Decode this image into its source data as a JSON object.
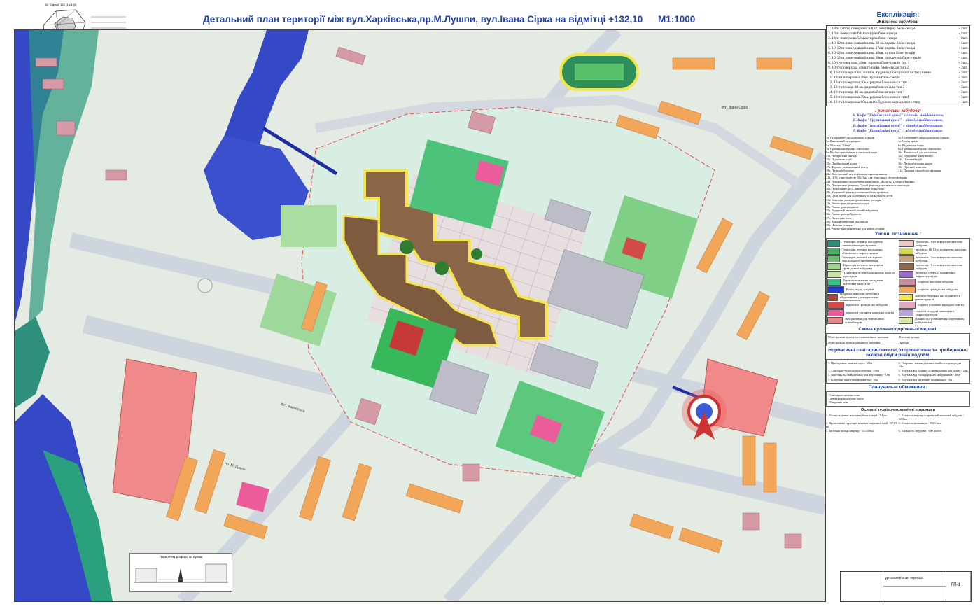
{
  "title": "Детальний план території між вул.Харківська,пр.М.Лушпи, вул.Івана Сірка на  відмітці +132,10",
  "scale": "М1:1000",
  "legend": {
    "explication_title": "Експлікація:",
    "housing_title": "Житлова забудова:",
    "housing": [
      {
        "text": "1. 18ти (20ти) поверхова 64(92) квартирна блок-секція",
        "count": "- 2шт."
      },
      {
        "text": "2. 16ти поверхова 68квартирна блок-секція",
        "count": "- 4шт."
      },
      {
        "text": "3. 14ти поверхова 52квартирна блок-секція",
        "count": "- 10шт."
      },
      {
        "text": "4. 10-12ти поверхова кінцева 38 кв.рядова блок-секція",
        "count": "- 4шт."
      },
      {
        "text": "5. 10-12ти поверхова кінцева 37кв. рядова блок-секція",
        "count": "- 4шт."
      },
      {
        "text": "6. 10-12ти поверхова кінцева 38кв. кутова блок-секція",
        "count": "- 4шт."
      },
      {
        "text": "7. 10-12ти поверхова кінцева 38кв. поворотна блок-секція",
        "count": "- 4шт."
      },
      {
        "text": "8. 10-ти поверхова 40кв. торцева блок-секція тип 1",
        "count": "- 2шт."
      },
      {
        "text": "9. 10-ти поверхова 40кв.торцева блок-секція тип 2",
        "count": "- 2шт."
      },
      {
        "text": "10. 10-ти повер.40кв. житлов. будинок повторного застосування",
        "count": "- 3шт."
      },
      {
        "text": "11. 10-ти поверхова 40кв. кутова блок-секція",
        "count": "- 3шт."
      },
      {
        "text": "12. 10-ти поверхова 40кв. рядова блок-секція тип 1",
        "count": "- 2шт."
      },
      {
        "text": "13. 10-ти повер. 38 кв. рядова блок-секція тип 2",
        "count": "- 3шт."
      },
      {
        "text": "14. 10-ти повер. 40 кв. рядова блок-секція тип 3",
        "count": "- 3шт."
      },
      {
        "text": "15. 10-ти поверхова 39кв. рядова блок-секція тип4",
        "count": "- 3шт."
      },
      {
        "text": "16. 10-ти поверхова 60кв.житл.будинок коридорного типу",
        "count": "- 1шт."
      }
    ],
    "public_title": "Громадська забудова:",
    "public": [
      "А. Кафе \"Український кухні\" з літнім майданчиком.",
      "Б. Кафе \"Грузинської кухні\" з літнім майданчиком.",
      "В. Кафе \"Італійської кухні\" з літнім майданчиком.",
      "Г. Кафе \"Китайської кухні\" з літнім майданчиком."
    ],
    "facilities": [
      [
        "1а. Супермаркет продовольчих товарів",
        "2а. Супермаркет непродовольчих товарів"
      ],
      [
        "3а. Книжковий супермаркет",
        "4а. Салон краси"
      ],
      [
        "5а. Магазин \"Квіти\"",
        "6а. Відділення банку"
      ],
      [
        "7а. Приймальний пункт хімчистки",
        "8а. Приймальний пункт хімчистки"
      ],
      [
        "9а. Клубні приміщення зі школою танців",
        "10а. Фітнесклуб для населення"
      ],
      [
        "11а. Нотаріальна контора",
        "12а. Юридичні консультації"
      ],
      [
        "13а. Підліткова клуб",
        "14а. Шаховий клуб"
      ],
      [
        "15а. Приймальний пункт",
        "16а. Дитяча художня школа"
      ],
      [
        "17а. Торгово-розважальний центр",
        "18а. Офісний комплекс"
      ],
      [
        "19а. Дитяча бібліотека",
        "21а. Пральня самообслуговування"
      ]
    ],
    "notes": [
      "22а. Вистовочний зал з офісними приміщеннями.",
      "23а. ЦОК з вмістимістю 10х25м2 для технічного обслуговування.",
      "24а. Декоративно-скульптурна композиція. Місце під Поворот Княжну.",
      "25а. Декоративні фонтани. Сухий фонтан для освіжання пішоходів.",
      "26а. Пішохідний міст. Декоративна водна зона.",
      "29а. Музичний фонтан з композиційним графіком.",
      "30а. Поля зелені для відпочинку та фізкультури дітей.",
      "31а. Комплекс дитячих дошкільних закладів.",
      "32а. Реконструкція дитячого садка.",
      "33а. Реконструкція школи.",
      "35а. Відкритий автомобільний майданчик.",
      "36а. Реконструкція будівель.",
      "37а. Пішохідна алея.",
      "38а. Трансформаторна підстанція.",
      "39а. Насосна станція.",
      "40а. Реконструкція котельні для нових об'єктів."
    ],
    "legend_title": "Умовні позначення :",
    "symbols": [
      {
        "color": "#2a8f7a",
        "text": "Територія зелених насаджень загального користування"
      },
      {
        "color": "#f0c7c7",
        "text": "проектна 18ти поверхова житлова забудова"
      },
      {
        "color": "#4caf66",
        "text": "Територія зелених насаджень обмеженого користування"
      },
      {
        "color": "#d8d84c",
        "text": "проектна 16-12ти поверхова житлова забудова"
      },
      {
        "color": "#6cbd72",
        "text": "Територія зелених насаджень спеціального призначення"
      },
      {
        "color": "#c8a07a",
        "text": "проектна 14ти поверхова житлова забудова"
      },
      {
        "color": "#9ed38c",
        "text": "Територія зелених насаджень громадської забудови"
      },
      {
        "color": "#8c6a4a",
        "text": "проектна 10ти поверхова житлова забудова"
      },
      {
        "color": "#c9e2a5",
        "text": "Територія зелених насаджень шкіл та дитсадків"
      },
      {
        "color": "#9a6bc8",
        "text": "проектні споруди інженерної інфраструктури"
      },
      {
        "color": "#33c089",
        "text": "Територія зелених насаджень житлових кварталів"
      },
      {
        "color": "#c98a9a",
        "text": "існуюча житлова забудова"
      },
      {
        "color": "#1f3fd0",
        "text": "Річки, води, існуючі"
      },
      {
        "color": "#f1a65a",
        "text": "існуюча громадська забудова"
      },
      {
        "color": "#a8453a",
        "text": "проектна житлова забудова з вбудованими громадськими приміщеннями"
      },
      {
        "color": "#f0e65a",
        "text": "житлова будинки, які підлягають реконструкції"
      },
      {
        "color": "#d24a4a",
        "text": "проектна громадська забудова"
      },
      {
        "color": "#e3a7c8",
        "text": "існуючі установи народної освіти"
      },
      {
        "color": "#ea5c9a",
        "text": "проектні установи народної освіти"
      },
      {
        "color": "#b9a4d8",
        "text": "існуючі споруди інженерної інфраструктури"
      },
      {
        "color": "#e98a8a",
        "text": "майданчики для тимчасових контейнерів"
      },
      {
        "color": "#d9e9a8",
        "text": "ділянки під розміщення спортивних майданчиків"
      }
    ],
    "road_title": "Схема вулично-дорожньої мережі:",
    "roads": [
      "Магістральна вулиця загальноміського значення",
      "Житлова вулиця",
      "Магістральна вулиця районного значення",
      "Проїзди"
    ],
    "zones_title": "Нормативні санітарно-захисні,охоронні зони та прибережно-захисні смуги річки,водойм:",
    "zones": [
      "1. Прибережна захисна смуга - 25м",
      "2. Охоронна зона надземних ліній електропередач - 10м",
      "3. Санітарно-захисна зона котельні - 50м",
      "4. Відстань від будинку до майданчика для сміття - 20м",
      "5. Відстань від майданчиків для відпочинку - 10м",
      "6. Відстань від господарських майданчиків - 20м",
      "7. Охоронна зона трансформатора - 10м",
      "8. Відстань від підземних комунікацій - 5м"
    ],
    "planning_title": "Планувальні обмеження :",
    "planning": [
      "- Санітарно-захисна зона",
      "- Прибережна захисна смуга",
      "- Охоронна зона"
    ],
    "indicators_title": "Основні техніко-економічні показники",
    "indicators": [
      "1. Кількість нових житлових блок-секцій - 54 шт.",
      "2. Кількість квартир в проектній житловій забудові - 2260кв.",
      "3. Проектована територія в межах червоних ліній - 37,83 га",
      "4. Кількість мешканців - 6920 чол.",
      "5. Загальна площа квартир - 111350м2",
      "6. Щільність забудови - 960 чол/га"
    ]
  },
  "map": {
    "street_labels": [
      "вул. Харківська",
      "вул. Івана Сірка",
      "пр. М. Лушпи"
    ],
    "inset_title": "Поперечна розрізка по вулиці",
    "orientation_title": "ВС \"Одеса\" 132 (1м:100)"
  },
  "stamp": {
    "title": "Детальний план території",
    "sheet": "ГП-1"
  },
  "colors": {
    "water": "#3650c9",
    "residential_existing": "#c98a9a",
    "public_existing": "#f1a65a",
    "greenery": "#4caf66",
    "road": "#d7dbe2",
    "title": "#1f3fae"
  }
}
